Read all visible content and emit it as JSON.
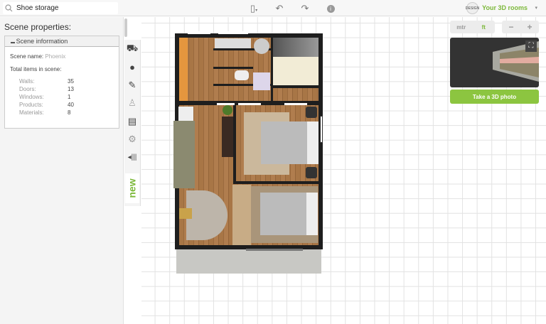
{
  "search": {
    "value": "Shoe storage"
  },
  "toolbar": {
    "new_icon": "file-icon",
    "undo_icon": "undo-icon",
    "redo_icon": "redo-icon",
    "info_icon": "info-icon"
  },
  "account": {
    "logo_text": "DESIGN",
    "label": "Your 3D rooms",
    "caret": "▾"
  },
  "left": {
    "title": "Scene properties:",
    "section": "Scene information",
    "collapse": "▪",
    "scene_name_label": "Scene name:",
    "scene_name": "Phoenix",
    "total_label": "Total items in scene:",
    "counts": [
      {
        "label": "Walls:",
        "value": "35"
      },
      {
        "label": "Doors:",
        "value": "13"
      },
      {
        "label": "Windows:",
        "value": "1"
      },
      {
        "label": "Products:",
        "value": "40"
      },
      {
        "label": "Materials:",
        "value": "8"
      }
    ]
  },
  "tools": {
    "new_label": "new"
  },
  "units": {
    "metric": "mtr",
    "imperial": "ft",
    "active": "ft"
  },
  "zoom": {
    "minus": "−",
    "plus": "+"
  },
  "preview": {
    "button": "Take a 3D photo"
  },
  "colors": {
    "accent": "#8cc540"
  }
}
